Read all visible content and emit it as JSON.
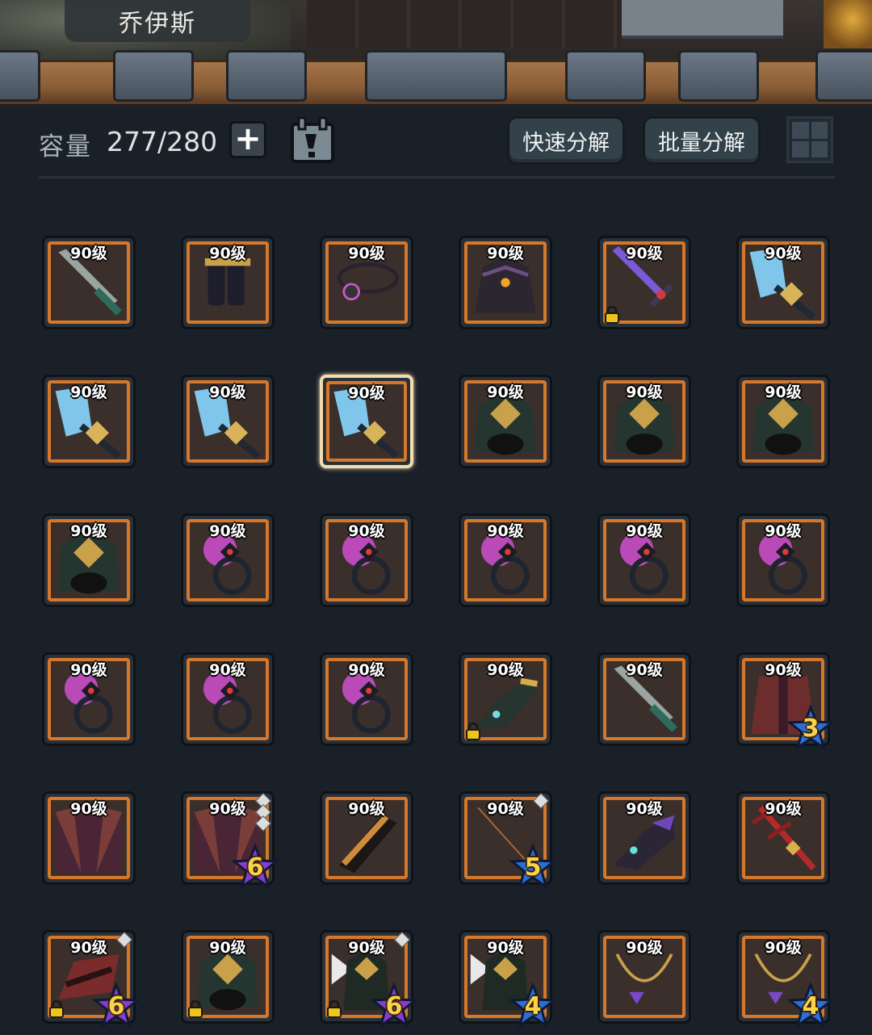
{
  "header": {
    "character_name": "乔伊斯"
  },
  "toolbar": {
    "capacity_label": "容量",
    "capacity_value": "277/280",
    "quick_decompose_label": "快速分解",
    "batch_decompose_label": "批量分解"
  },
  "items": [
    {
      "level": "90级",
      "art": "green-blade",
      "lock": false,
      "stars": null
    },
    {
      "level": "90级",
      "art": "dark-boots",
      "lock": false,
      "stars": null
    },
    {
      "level": "90级",
      "art": "spike-necklace",
      "lock": false,
      "stars": null
    },
    {
      "level": "90级",
      "art": "demon-helm",
      "lock": false,
      "stars": null
    },
    {
      "level": "90级",
      "art": "violet-sword",
      "lock": true,
      "stars": null
    },
    {
      "level": "90级",
      "art": "ice-axe",
      "lock": false,
      "stars": null
    },
    {
      "level": "90级",
      "art": "ice-axe",
      "lock": false,
      "stars": null
    },
    {
      "level": "90级",
      "art": "ice-axe",
      "lock": false,
      "stars": null
    },
    {
      "level": "90级",
      "art": "ice-axe",
      "lock": false,
      "stars": null,
      "selected": true
    },
    {
      "level": "90级",
      "art": "gold-armor",
      "lock": false,
      "stars": null
    },
    {
      "level": "90级",
      "art": "gold-armor",
      "lock": false,
      "stars": null
    },
    {
      "level": "90级",
      "art": "gold-armor",
      "lock": false,
      "stars": null
    },
    {
      "level": "90级",
      "art": "gold-armor",
      "lock": false,
      "stars": null
    },
    {
      "level": "90级",
      "art": "pink-ring",
      "lock": false,
      "stars": null
    },
    {
      "level": "90级",
      "art": "pink-ring",
      "lock": false,
      "stars": null
    },
    {
      "level": "90级",
      "art": "pink-ring",
      "lock": false,
      "stars": null
    },
    {
      "level": "90级",
      "art": "pink-ring",
      "lock": false,
      "stars": null
    },
    {
      "level": "90级",
      "art": "pink-ring",
      "lock": false,
      "stars": null
    },
    {
      "level": "90级",
      "art": "pink-ring",
      "lock": false,
      "stars": null
    },
    {
      "level": "90级",
      "art": "pink-ring",
      "lock": false,
      "stars": null
    },
    {
      "level": "90级",
      "art": "pink-ring",
      "lock": false,
      "stars": null
    },
    {
      "level": "90级",
      "art": "gold-gauntlet",
      "lock": true,
      "stars": null
    },
    {
      "level": "90级",
      "art": "green-blade",
      "lock": false,
      "stars": null
    },
    {
      "level": "90级",
      "art": "red-robe",
      "lock": false,
      "stars": "3",
      "star_color": "blue"
    },
    {
      "level": "90级",
      "art": "purple-cloak",
      "lock": false,
      "stars": null
    },
    {
      "level": "90级",
      "art": "purple-cloak",
      "lock": false,
      "stars": "6",
      "star_color": "purple",
      "diamonds": 3
    },
    {
      "level": "90级",
      "art": "orange-bracer",
      "lock": false,
      "stars": null
    },
    {
      "level": "90级",
      "art": "bronze-bow",
      "lock": false,
      "stars": "5",
      "star_color": "blue",
      "diamonds": 1
    },
    {
      "level": "90级",
      "art": "purple-gauntlet",
      "lock": false,
      "stars": null
    },
    {
      "level": "90级",
      "art": "red-trident",
      "lock": false,
      "stars": null
    },
    {
      "level": "90级",
      "art": "red-helm",
      "lock": true,
      "stars": "6",
      "star_color": "purple",
      "diamonds": 1
    },
    {
      "level": "90级",
      "art": "gold-armor",
      "lock": true,
      "stars": null
    },
    {
      "level": "90级",
      "art": "winged-armor",
      "lock": true,
      "stars": "6",
      "star_color": "purple",
      "diamonds": 1
    },
    {
      "level": "90级",
      "art": "winged-armor",
      "lock": false,
      "stars": "4",
      "star_color": "blue"
    },
    {
      "level": "90级",
      "art": "gold-necklace",
      "lock": false,
      "stars": null
    },
    {
      "level": "90级",
      "art": "gold-necklace",
      "lock": false,
      "stars": "4",
      "star_color": "blue"
    }
  ],
  "colors": {
    "background": "#1a2027",
    "slot_border": "#d6782c",
    "selected_outline": "#f3dcb0",
    "star_blue": "#2a6fd6",
    "star_purple": "#8a3bd2",
    "star_number": "#f6d34a"
  }
}
